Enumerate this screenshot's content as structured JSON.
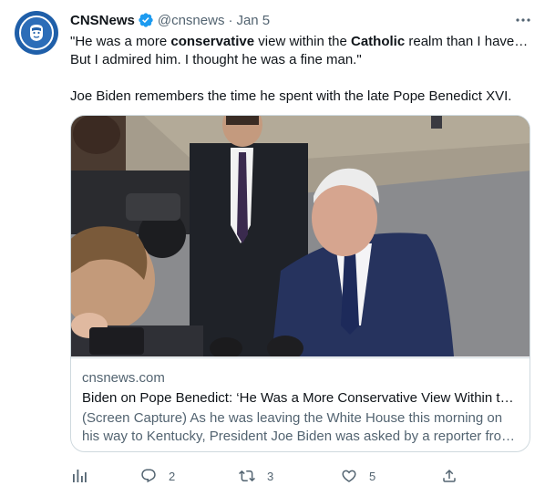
{
  "author": {
    "display_name": "CNSNews",
    "handle": "@cnsnews",
    "separator": "·",
    "date": "Jan 5"
  },
  "tweet": {
    "line1_a": "\"He was a more ",
    "line1_b": "conservative",
    "line1_c": " view within the ",
    "line1_d": "Catholic",
    "line1_e": " realm than I have…",
    "line2": "But I admired him. I thought he was a fine man.\"",
    "line3": "Joe Biden remembers the time he spent with the late Pope Benedict XVI."
  },
  "card": {
    "domain": "cnsnews.com",
    "title": "Biden on Pope Benedict: ‘He Was a More Conservative View Within th…",
    "description_1": "(Screen Capture) As he was leaving the White House this morning on",
    "description_2": "his way to Kentucky, President Joe Biden was asked by a reporter fro…"
  },
  "actions": {
    "replies": "2",
    "retweets": "3",
    "likes": "5"
  },
  "colors": {
    "secondary_text": "#536471",
    "verified_blue": "#1d9bf0",
    "border": "#cfd9de"
  },
  "icons": [
    "analytics-icon",
    "reply-icon",
    "retweet-icon",
    "like-icon",
    "share-icon",
    "more-icon",
    "verified-badge-icon"
  ]
}
